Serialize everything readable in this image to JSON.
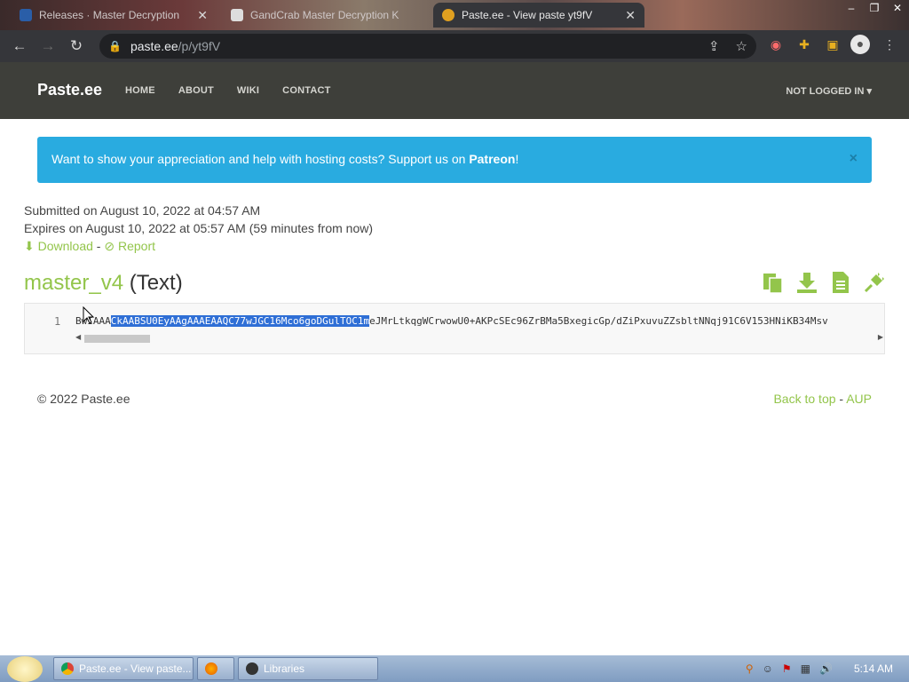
{
  "browser": {
    "tabs": [
      {
        "title": "Releases · Master Decryption",
        "active": false
      },
      {
        "title": "GandCrab Master Decryption K",
        "active": false
      },
      {
        "title": "Paste.ee - View paste yt9fV",
        "active": true
      }
    ],
    "url_host": "paste.ee",
    "url_path": "/p/yt9fV"
  },
  "site": {
    "brand": "Paste.ee",
    "nav": [
      "HOME",
      "ABOUT",
      "WIKI",
      "CONTACT"
    ],
    "login": "NOT LOGGED IN"
  },
  "banner": {
    "text": "Want to show your appreciation and help with hosting costs? Support us on ",
    "link": "Patreon",
    "suffix": "!",
    "close": "×"
  },
  "paste": {
    "submitted": "Submitted on August 10, 2022 at 04:57 AM",
    "expires": "Expires on August 10, 2022 at 05:57 AM (59 minutes from now)",
    "download": "Download",
    "separator": "-",
    "report": "Report",
    "name": "master_v4",
    "type": "(Text)",
    "line_number": "1",
    "code_before": "BwIAAA",
    "code_selected": "CkAABSU0EyAAgAAAEAAQC77wJGC16Mco6goDGulTOC1m",
    "code_after": "eJMrLtkqgWCrwowU0+AKPcSEc96ZrBMa5BxegicGp/dZiPxuvuZZsbltNNqj91C6V153HNiKB34Msv"
  },
  "footer": {
    "copyright": "© 2022 Paste.ee",
    "back_to_top": "Back to top",
    "separator": "-",
    "aup": "AUP"
  },
  "taskbar": {
    "buttons": [
      "Paste.ee - View paste...",
      "Libraries"
    ],
    "clock": "5:14 AM"
  },
  "colors": {
    "accent_green": "#93c54b",
    "banner_blue": "#29abe0",
    "navbar": "#3e3f3a"
  }
}
